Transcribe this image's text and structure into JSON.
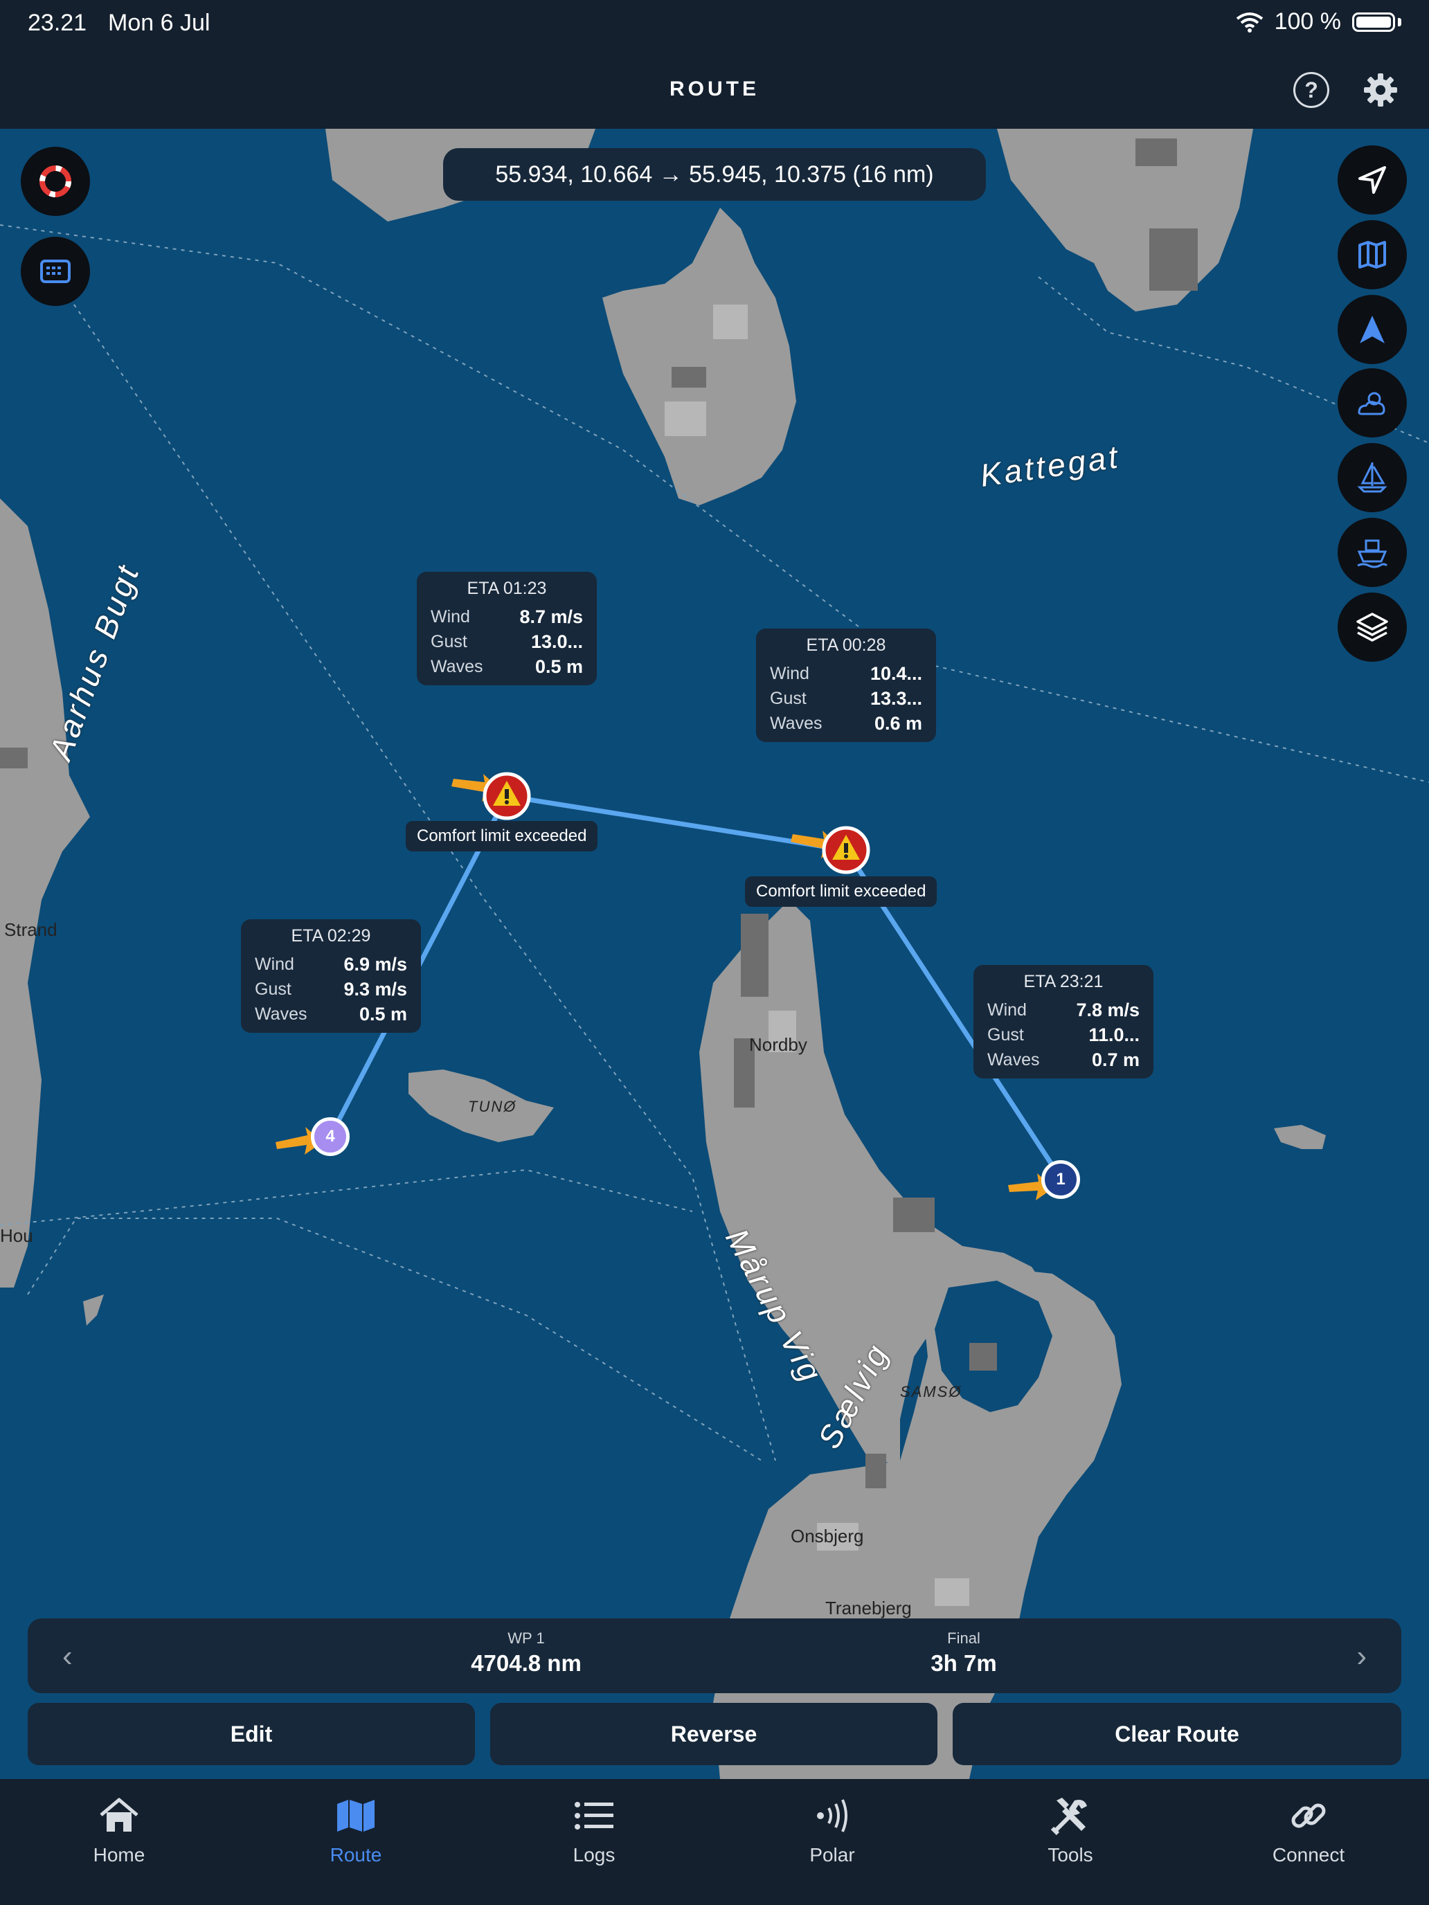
{
  "status": {
    "time": "23.21",
    "date": "Mon 6 Jul",
    "battery": "100 %"
  },
  "header": {
    "title": "ROUTE",
    "help_icon": "question-icon",
    "settings_icon": "gear-icon"
  },
  "map": {
    "coords": "55.934, 10.664 → 55.945, 10.375 (16 nm)",
    "places": {
      "kattegat": "Kattegat",
      "aarhus_bugt": "Aarhus Bugt",
      "marup_vig": "Mårup Vig",
      "saelvig": "Sælvig",
      "nordby": "Nordby",
      "tuno": "TUNØ",
      "samso": "SAMSØ",
      "onsbjerg": "Onsbjerg",
      "tranebjerg": "Tranebjerg",
      "strand": "Strand",
      "hou": "Hou"
    },
    "waypoints": [
      {
        "label": "1",
        "color": "#1f3f8c"
      },
      {
        "label": "4",
        "color": "#a78df0"
      }
    ],
    "warning_text": "Comfort limit exceeded",
    "eta_cards": [
      {
        "title": "ETA 01:23",
        "wind_label": "Wind",
        "wind": "8.7 m/s",
        "gust_label": "Gust",
        "gust": "13.0...",
        "waves_label": "Waves",
        "waves": "0.5 m"
      },
      {
        "title": "ETA 00:28",
        "wind_label": "Wind",
        "wind": "10.4...",
        "gust_label": "Gust",
        "gust": "13.3...",
        "waves_label": "Waves",
        "waves": "0.6 m"
      },
      {
        "title": "ETA 02:29",
        "wind_label": "Wind",
        "wind": "6.9 m/s",
        "gust_label": "Gust",
        "gust": "9.3 m/s",
        "waves_label": "Waves",
        "waves": "0.5 m"
      },
      {
        "title": "ETA 23:21",
        "wind_label": "Wind",
        "wind": "7.8 m/s",
        "gust_label": "Gust",
        "gust": "11.0...",
        "waves_label": "Waves",
        "waves": "0.7 m"
      }
    ],
    "left_buttons": [
      "lifebuoy-icon",
      "keyboard-icon"
    ],
    "right_buttons": [
      "navigation-arrow-icon",
      "map-icon",
      "heading-arrow-icon",
      "weather-icon",
      "sailboat-icon",
      "ship-icon",
      "layers-icon"
    ]
  },
  "info_panel": {
    "wp_label": "WP 1",
    "wp_value": "4704.8 nm",
    "final_label": "Final",
    "final_value": "3h 7m"
  },
  "actions": {
    "edit": "Edit",
    "reverse": "Reverse",
    "clear": "Clear Route"
  },
  "tabs": [
    {
      "label": "Home",
      "icon": "home-icon"
    },
    {
      "label": "Route",
      "icon": "route-map-icon"
    },
    {
      "label": "Logs",
      "icon": "list-icon"
    },
    {
      "label": "Polar",
      "icon": "polar-icon"
    },
    {
      "label": "Tools",
      "icon": "tools-icon"
    },
    {
      "label": "Connect",
      "icon": "link-icon"
    }
  ],
  "colors": {
    "accent": "#4a8cf0",
    "sea": "#0b4b77",
    "land": "#9a9a9a",
    "warning": "#c8211d",
    "route": "#5aa6ef",
    "arrow": "#f2a11f"
  }
}
